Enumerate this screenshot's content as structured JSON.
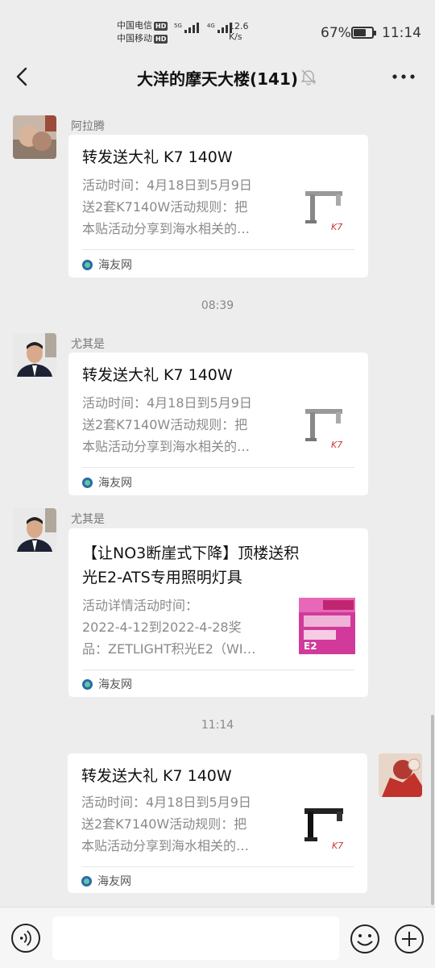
{
  "status_bar": {
    "carrier1": "中国电信",
    "carrier2": "中国移动",
    "hd": "HD",
    "net1": "5G",
    "net2": "4G",
    "speed_value": "12.6",
    "speed_unit": "K/s",
    "battery_pct": "67%",
    "battery_level": 0.67,
    "time": "11:14"
  },
  "header": {
    "title": "大洋的摩天大楼(141)",
    "back_icon": "chevron-left-icon",
    "mute_icon": "bell-off-icon",
    "more_icon": "more-icon"
  },
  "messages": [
    {
      "sender": "阿拉腾",
      "title": "转发送大礼 K7 140W",
      "desc": [
        "活动时间：4月18日到5月9日",
        "送2套K7140W活动规则：把",
        "本贴活动分享到海水相关的…"
      ],
      "source": "海友网"
    },
    {
      "time": "08:39"
    },
    {
      "sender": "尤其是",
      "title": "转发送大礼 K7 140W",
      "desc": [
        "活动时间：4月18日到5月9日",
        "送2套K7140W活动规则：把",
        "本贴活动分享到海水相关的…"
      ],
      "source": "海友网"
    },
    {
      "sender": "尤其是",
      "title_lines": [
        "【让NO3断崖式下降】顶楼送积",
        "光E2-ATS专用照明灯具"
      ],
      "desc": [
        "活动详情活动时间：",
        "2022-4-12到2022-4-28奖",
        "品：ZETLIGHT积光E2（WI…"
      ],
      "source": "海友网",
      "thumb_text": "E2"
    },
    {
      "time": "11:14"
    },
    {
      "self": true,
      "title": "转发送大礼 K7 140W",
      "desc": [
        "活动时间：4月18日到5月9日",
        "送2套K7140W活动规则：把",
        "本贴活动分享到海水相关的…"
      ],
      "source": "海友网"
    }
  ],
  "input_bar": {
    "voice_icon": "voice-icon",
    "emoji_icon": "emoji-icon",
    "plus_icon": "plus-icon"
  }
}
